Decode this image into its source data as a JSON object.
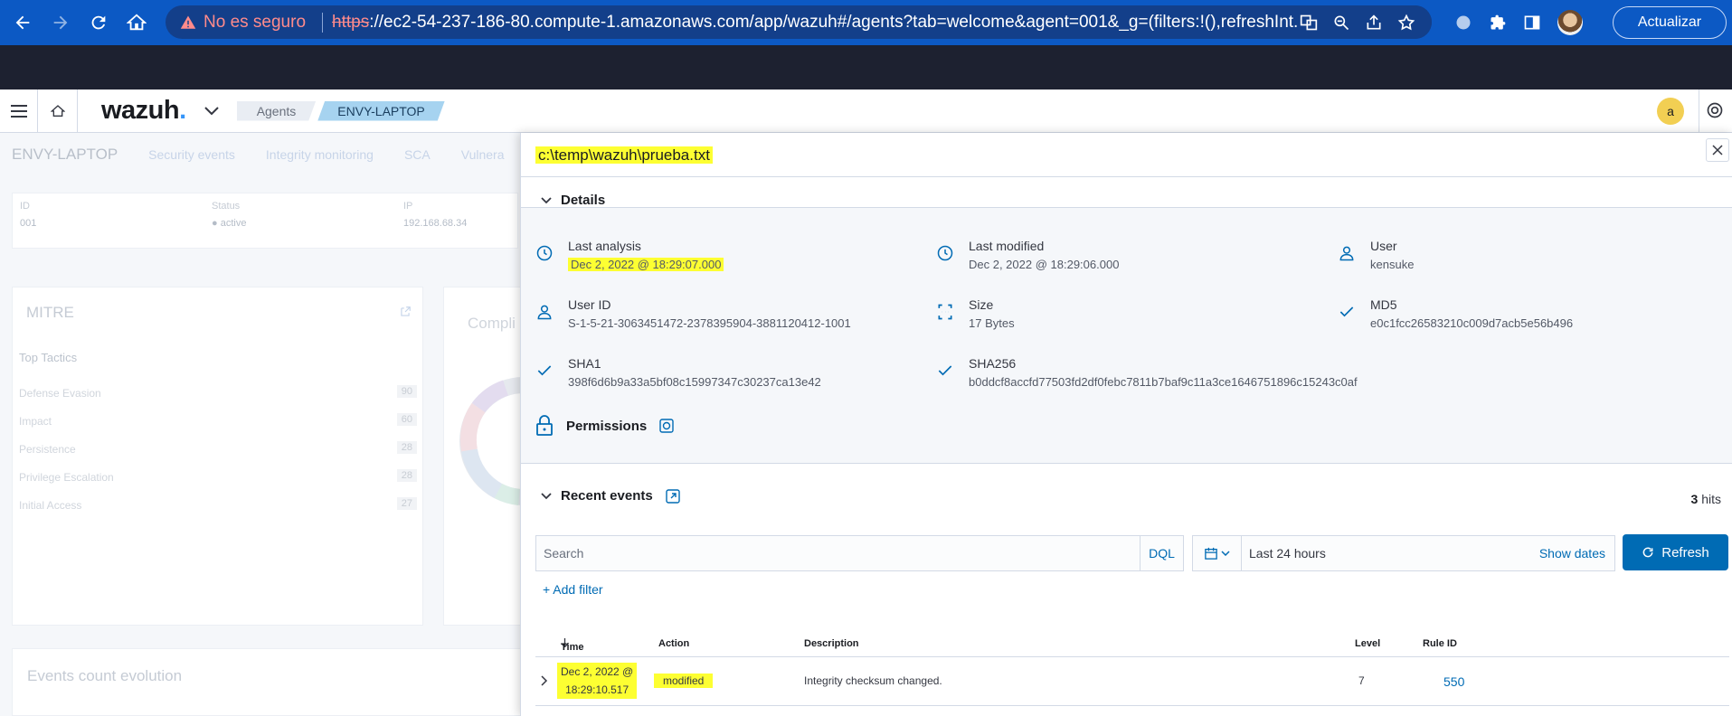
{
  "browser": {
    "security_label": "No es seguro",
    "url_scheme": "https",
    "url_rest": "://ec2-54-237-186-80.compute-1.amazonaws.com/app/wazuh#/agents?tab=welcome&agent=001&_g=(filters:!(),refreshInt...",
    "update_label": "Actualizar"
  },
  "header": {
    "logo": "wazuh",
    "breadcrumbs": [
      "Agents",
      "ENVY-LAPTOP"
    ],
    "user_initial": "a"
  },
  "background": {
    "agent_name": "ENVY-LAPTOP",
    "tabs": [
      "Security events",
      "Integrity monitoring",
      "SCA",
      "Vulnera"
    ],
    "info": {
      "id_label": "ID",
      "id_value": "001",
      "status_label": "Status",
      "status_value": "active",
      "ip_label": "IP",
      "ip_value": "192.168.68.34"
    },
    "mitre": {
      "title": "MITRE",
      "subtitle": "Top Tactics",
      "tactics": [
        {
          "name": "Defense Evasion",
          "count": "90"
        },
        {
          "name": "Impact",
          "count": "60"
        },
        {
          "name": "Persistence",
          "count": "28"
        },
        {
          "name": "Privilege Escalation",
          "count": "28"
        },
        {
          "name": "Initial Access",
          "count": "27"
        }
      ]
    },
    "compliance_title": "Compli",
    "events_title": "Events count evolution"
  },
  "flyout": {
    "title": "c:\\temp\\wazuh\\prueba.txt",
    "details_label": "Details",
    "fields": [
      {
        "label": "Last analysis",
        "value": "Dec 2, 2022 @ 18:29:07.000"
      },
      {
        "label": "Last modified",
        "value": "Dec 2, 2022 @ 18:29:06.000"
      },
      {
        "label": "User",
        "value": "kensuke"
      },
      {
        "label": "User ID",
        "value": "S-1-5-21-3063451472-2378395904-3881120412-1001"
      },
      {
        "label": "Size",
        "value": "17 Bytes"
      },
      {
        "label": "MD5",
        "value": "e0c1fcc26583210c009d7acb5e56b496"
      },
      {
        "label": "SHA1",
        "value": "398f6d6b9a33a5bf08c15997347c30237ca13e42"
      },
      {
        "label": "SHA256",
        "value": "b0ddcf8accfd77503fd2df0febc7811b7baf9c11a3ce1646751896c15243c0af"
      }
    ],
    "permissions_label": "Permissions",
    "recent_events_label": "Recent events",
    "hits_count": "3",
    "hits_label": "hits",
    "search_placeholder": "Search",
    "dql_label": "DQL",
    "date_range": "Last 24 hours",
    "show_dates_label": "Show dates",
    "refresh_label": "Refresh",
    "add_filter_label": "+ Add filter",
    "table": {
      "columns": [
        "Time",
        "Action",
        "Description",
        "Level",
        "Rule ID"
      ],
      "rows": [
        {
          "time_line1": "Dec 2, 2022 @",
          "time_line2": "18:29:10.517",
          "action": "modified",
          "description": "Integrity checksum changed.",
          "level": "7",
          "rule_id": "550"
        }
      ]
    }
  }
}
